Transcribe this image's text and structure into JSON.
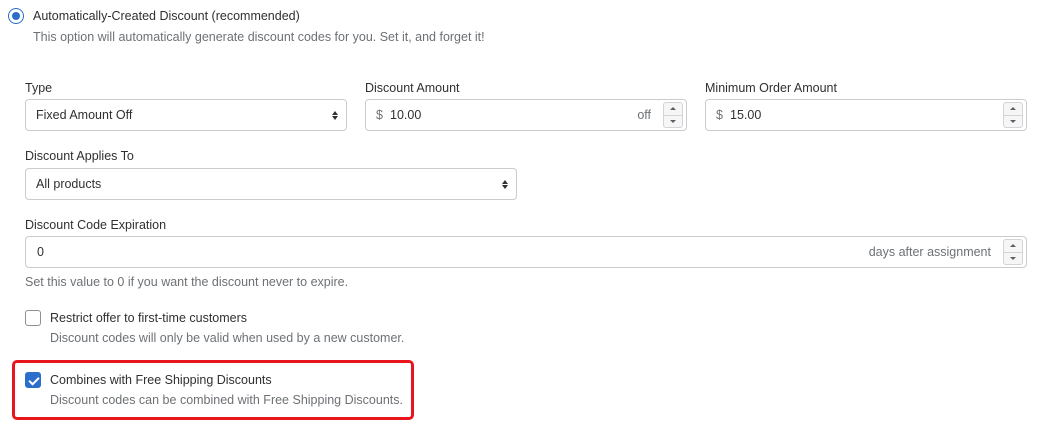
{
  "discount_mode": {
    "label": "Automatically-Created Discount (recommended)",
    "help": "This option will automatically generate discount codes for you. Set it, and forget it!",
    "selected": true
  },
  "type_field": {
    "label": "Type",
    "value": "Fixed Amount Off"
  },
  "discount_amount": {
    "label": "Discount Amount",
    "prefix": "$",
    "value": "10.00",
    "suffix": "off"
  },
  "minimum_order": {
    "label": "Minimum Order Amount",
    "prefix": "$",
    "value": "15.00"
  },
  "applies_to": {
    "label": "Discount Applies To",
    "value": "All products"
  },
  "expiration": {
    "label": "Discount Code Expiration",
    "value": "0",
    "suffix": "days after assignment",
    "help": "Set this value to 0 if you want the discount never to expire."
  },
  "restrict_first_time": {
    "label": "Restrict offer to first-time customers",
    "help": "Discount codes will only be valid when used by a new customer.",
    "checked": false
  },
  "combine_free_shipping": {
    "label": "Combines with Free Shipping Discounts",
    "help": "Discount codes can be combined with Free Shipping Discounts.",
    "checked": true,
    "highlight_color": "#e8161c"
  },
  "colors": {
    "accent": "#2c6ecb",
    "highlight": "#e8161c"
  }
}
